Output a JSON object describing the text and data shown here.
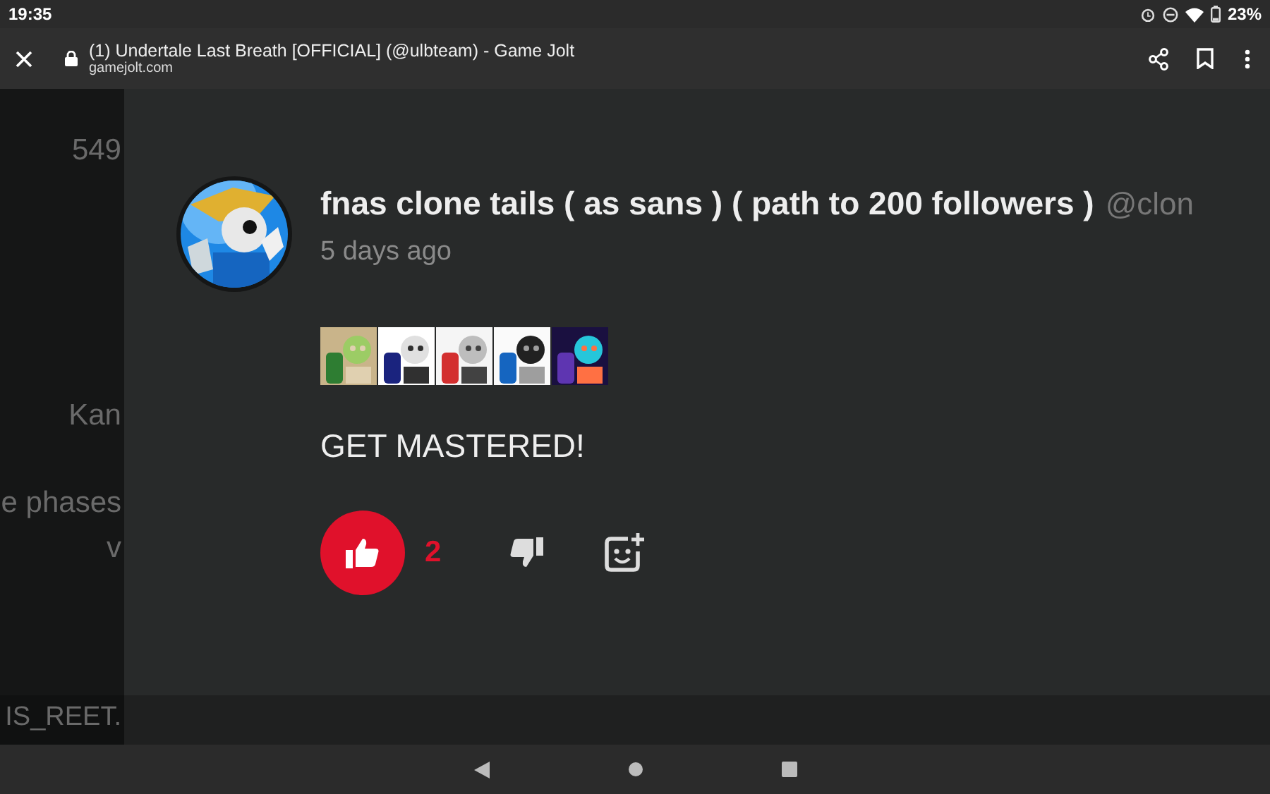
{
  "status_bar": {
    "time": "19:35",
    "battery": "23%"
  },
  "browser_bar": {
    "title": "(1) Undertale Last Breath [OFFICIAL] (@ulbteam) - Game Jolt",
    "url": "gamejolt.com"
  },
  "background_fragments": [
    "549",
    "Kan",
    "e phases",
    "v",
    "IS_REET."
  ],
  "post": {
    "author": "fnas clone tails ( as sans ) ( path to 200 followers )",
    "handle": "@clon",
    "time": "5 days ago",
    "message": "GET MASTERED!",
    "like": {
      "selected": true,
      "count": "2"
    }
  }
}
